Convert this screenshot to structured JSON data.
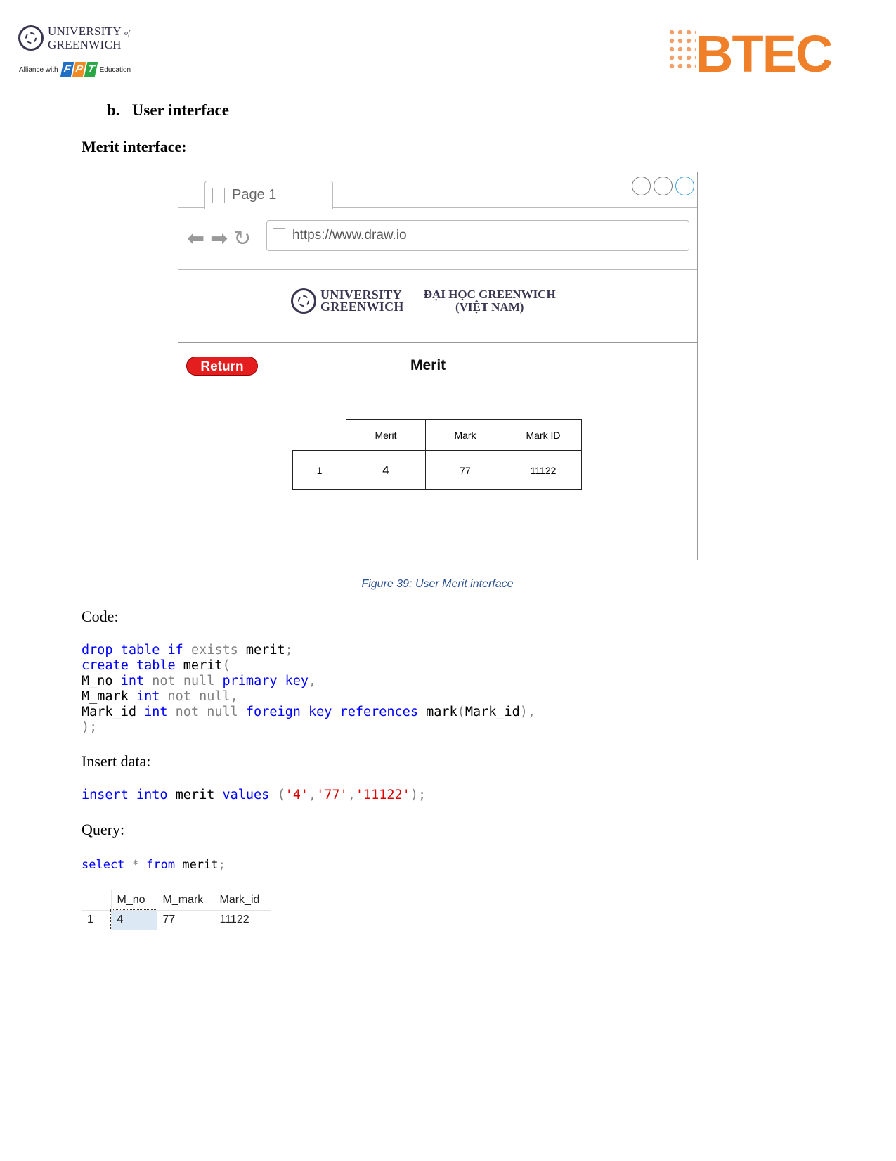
{
  "header": {
    "uog_line1": "UNIVERSITY",
    "uog_of": "of",
    "uog_line2": "GREENWICH",
    "alliance": "Alliance with",
    "alliance_edu": "Education",
    "fpt": [
      "F",
      "P",
      "T"
    ],
    "btec": "BTEC",
    "fpt_colors": [
      "#1f6fc4",
      "#f08a24",
      "#2aa845"
    ]
  },
  "heading_b": "b.   User interface",
  "heading_merit": "Merit interface:",
  "mockup": {
    "tab_label": "Page 1",
    "url": "https://www.draw.io",
    "nav_icons": [
      "arrow-left-icon",
      "arrow-right-icon",
      "refresh-icon"
    ],
    "logo_uog": [
      "UNIVERSITY",
      "GREENWICH"
    ],
    "logo_viet": [
      "ĐẠI HỌC GREENWICH",
      "(VIỆT NAM)"
    ],
    "return_label": "Return",
    "title": "Merit",
    "table": {
      "headers": [
        "Merit",
        "Mark",
        "Mark ID"
      ],
      "rows": [
        [
          "1",
          "4",
          "77",
          "11122"
        ]
      ]
    }
  },
  "caption": "Figure 39: User Merit interface",
  "code_label": "Code:",
  "insert_label": "Insert data:",
  "query_label": "Query:",
  "code_lines": [
    [
      [
        "k",
        "drop table if "
      ],
      [
        "g",
        "exists "
      ],
      [
        "i",
        "merit"
      ],
      [
        "g",
        ";"
      ]
    ],
    [
      [
        "k",
        "create table "
      ],
      [
        "i",
        "merit"
      ],
      [
        "g",
        "("
      ]
    ],
    [
      [
        "i",
        "M_no "
      ],
      [
        "k",
        "int "
      ],
      [
        "g",
        "not null "
      ],
      [
        "k",
        "primary key"
      ],
      [
        "g",
        ","
      ]
    ],
    [
      [
        "i",
        "M_mark "
      ],
      [
        "k",
        "int "
      ],
      [
        "g",
        "not null,"
      ]
    ],
    [
      [
        "i",
        "Mark_id "
      ],
      [
        "k",
        "int "
      ],
      [
        "g",
        "not null "
      ],
      [
        "k",
        "foreign key references "
      ],
      [
        "i",
        "mark"
      ],
      [
        "g",
        "("
      ],
      [
        "i",
        "Mark_id"
      ],
      [
        "g",
        "),"
      ]
    ],
    [
      [
        "g",
        ");"
      ]
    ]
  ],
  "insert_lines": [
    [
      [
        "k",
        "insert into "
      ],
      [
        "i",
        "merit "
      ],
      [
        "k",
        "values "
      ],
      [
        "g",
        "("
      ],
      [
        "s",
        "'4'"
      ],
      [
        "g",
        ","
      ],
      [
        "s",
        "'77'"
      ],
      [
        "g",
        ","
      ],
      [
        "s",
        "'11122'"
      ],
      [
        "g",
        ");"
      ]
    ]
  ],
  "query_lines": [
    [
      [
        "k",
        "select "
      ],
      [
        "g",
        "* "
      ],
      [
        "k",
        "from "
      ],
      [
        "i",
        "merit"
      ],
      [
        "g",
        ";"
      ]
    ]
  ],
  "result_grid": {
    "headers": [
      "M_no",
      "M_mark",
      "Mark_id"
    ],
    "rows": [
      [
        "1",
        "4",
        "77",
        "11122"
      ]
    ]
  }
}
